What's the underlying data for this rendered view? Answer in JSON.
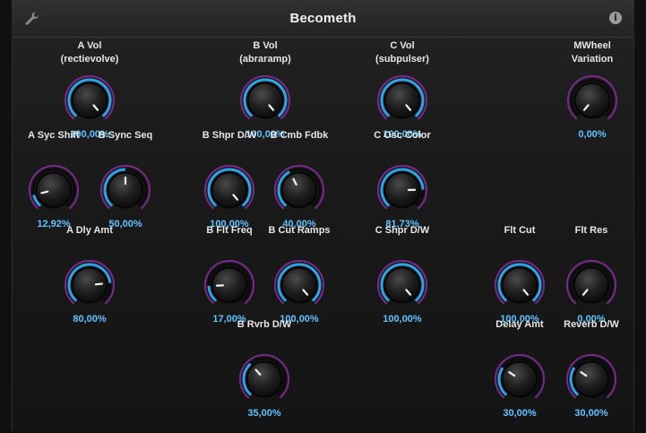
{
  "app": {
    "title": "Becometh"
  },
  "header": {
    "wrench_icon": "wrench-icon",
    "info_icon": "info-icon",
    "info_glyph": "i"
  },
  "colors": {
    "arc_outer": "#7a2a8c",
    "arc_value": "#2ea3e6",
    "value_text": "#5fc4ff",
    "label_text": "#e6e6e6"
  },
  "knobs": [
    {
      "id": "a-vol",
      "label1": "A Vol",
      "label2": "(rectievolve)",
      "value_text": "100,00%",
      "value": 1.0
    },
    {
      "id": "b-vol",
      "label1": "B Vol",
      "label2": "(abraramp)",
      "value_text": "100,00%",
      "value": 1.0
    },
    {
      "id": "c-vol",
      "label1": "C Vol",
      "label2": "(subpulser)",
      "value_text": "100,00%",
      "value": 1.0
    },
    {
      "id": "mwheel-variation",
      "label1": "MWheel",
      "label2": "Variation",
      "value_text": "0,00%",
      "value": 0.0
    },
    {
      "id": "a-syc-shift",
      "label1": "A Syc Shift",
      "label2": "",
      "value_text": "12,92%",
      "value": 0.1292
    },
    {
      "id": "b-sync-seq",
      "label1": "B Sync Seq",
      "label2": "",
      "value_text": "50,00%",
      "value": 0.5
    },
    {
      "id": "b-shpr-dw",
      "label1": "B Shpr D/W",
      "label2": "",
      "value_text": "100,00%",
      "value": 1.0
    },
    {
      "id": "b-cmb-fdbk",
      "label1": "B Cmb Fdbk",
      "label2": "",
      "value_text": "40,00%",
      "value": 0.4
    },
    {
      "id": "c-osc-color",
      "label1": "C Osc Color",
      "label2": "",
      "value_text": "81,73%",
      "value": 0.8173
    },
    {
      "id": "a-dly-amt",
      "label1": "A Dly Amt",
      "label2": "",
      "value_text": "80,00%",
      "value": 0.8
    },
    {
      "id": "b-flt-freq",
      "label1": "B Flt Freq",
      "label2": "",
      "value_text": "17,00%",
      "value": 0.17
    },
    {
      "id": "b-cut-ramps",
      "label1": "B Cut Ramps",
      "label2": "",
      "value_text": "100,00%",
      "value": 1.0
    },
    {
      "id": "c-shpr-dw",
      "label1": "C Shpr D/W",
      "label2": "",
      "value_text": "100,00%",
      "value": 1.0
    },
    {
      "id": "flt-cut",
      "label1": "Flt Cut",
      "label2": "",
      "value_text": "100,00%",
      "value": 1.0
    },
    {
      "id": "flt-res",
      "label1": "Flt Res",
      "label2": "",
      "value_text": "0,00%",
      "value": 0.0
    },
    {
      "id": "b-rvrb-dw",
      "label1": "B Rvrb D/W",
      "label2": "",
      "value_text": "35,00%",
      "value": 0.35
    },
    {
      "id": "delay-amt",
      "label1": "Delay Amt",
      "label2": "",
      "value_text": "30,00%",
      "value": 0.3
    },
    {
      "id": "reverb-dw",
      "label1": "Reverb D/W",
      "label2": "",
      "value_text": "30,00%",
      "value": 0.3
    }
  ]
}
